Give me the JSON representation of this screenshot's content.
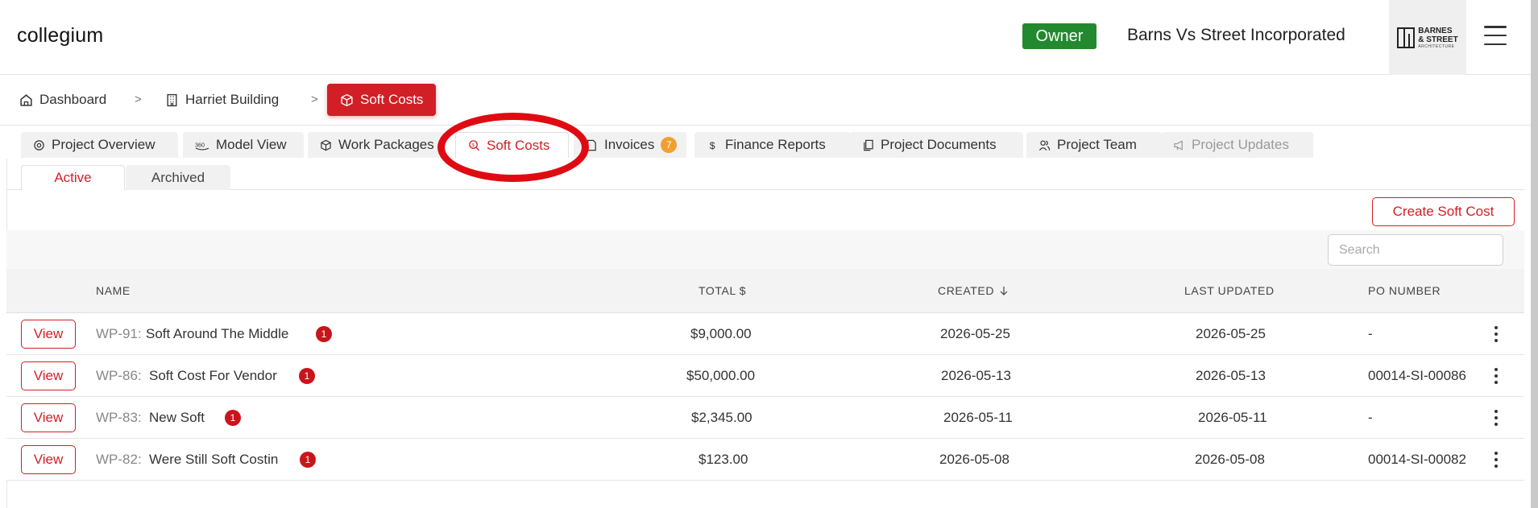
{
  "app": {
    "brand": "collegium",
    "role": "Owner",
    "company": "Barns Vs Street Incorporated",
    "logo": {
      "line1": "BARNES",
      "line2": "& STREET",
      "line3": "ARCHITECTURE"
    }
  },
  "breadcrumb": {
    "dashboard": "Dashboard",
    "sep1": ">",
    "building": "Harriet Building",
    "sep2": ">",
    "current": "Soft Costs"
  },
  "tabs": {
    "project_overview": "Project Overview",
    "model_view": "Model View",
    "work_packages": "Work Packages",
    "soft_costs": "Soft Costs",
    "invoices": "Invoices",
    "invoices_count": "7",
    "finance_reports": "Finance Reports",
    "project_documents": "Project Documents",
    "project_team": "Project Team",
    "project_updates": "Project Updates"
  },
  "subtabs": {
    "active": "Active",
    "archived": "Archived"
  },
  "toolbar": {
    "create_label": "Create Soft Cost",
    "search_placeholder": "Search"
  },
  "table": {
    "headers": {
      "name": "NAME",
      "total": "TOTAL $",
      "created": "CREATED",
      "last_updated": "LAST UPDATED",
      "po_number": "PO NUMBER"
    },
    "view_label": "View",
    "rows": [
      {
        "id": "WP-91:",
        "name": "Soft Around The Middle",
        "badge": "1",
        "total": "$9,000.00",
        "created": "2026-05-25",
        "updated": "2026-05-25",
        "po": "-"
      },
      {
        "id": "WP-86:",
        "name": "Soft Cost For Vendor",
        "badge": "1",
        "total": "$50,000.00",
        "created": "2026-05-13",
        "updated": "2026-05-13",
        "po": "00014-SI-00086"
      },
      {
        "id": "WP-83:",
        "name": "New Soft",
        "badge": "1",
        "total": "$2,345.00",
        "created": "2026-05-11",
        "updated": "2026-05-11",
        "po": "-"
      },
      {
        "id": "WP-82:",
        "name": "Were Still Soft Costin",
        "badge": "1",
        "total": "$123.00",
        "created": "2026-05-08",
        "updated": "2026-05-08",
        "po": "00014-SI-00082"
      }
    ]
  },
  "colors": {
    "accent": "#d11f25",
    "owner_badge": "#23892f",
    "invoice_badge": "#f0a030",
    "annotation_circle": "#e00b12"
  }
}
